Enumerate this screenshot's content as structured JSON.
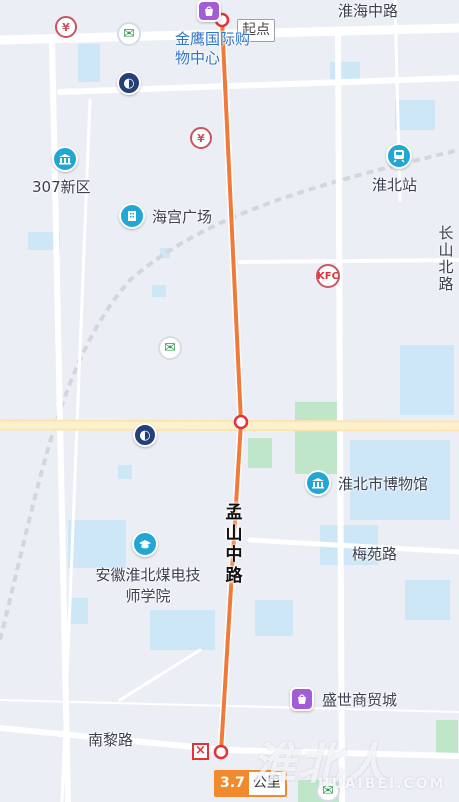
{
  "map": {
    "roads": {
      "huaihai_zhong": "淮海中路",
      "changshan_bei": "长山北路",
      "mengshan_zhong": "孟山中路",
      "meiyuan": "梅苑路",
      "nanli": "南黎路"
    },
    "pois": {
      "jinying": "金鹰国际购物中心",
      "huaibei_station": "淮北站",
      "district_307": "307新区",
      "haigong": "海宫广场",
      "museum": "淮北市博物馆",
      "technician_college": "安徽淮北煤电技师学院",
      "shengshi": "盛世商贸城"
    },
    "route": {
      "start_label": "起点",
      "distance_value": "3.7",
      "distance_unit": "公里",
      "color": "#f07a3a"
    },
    "icons": {
      "shopping": "shopping-bag-icon",
      "bank": "bank-icon",
      "post": "china-post-icon",
      "train": "train-station-icon",
      "museum": "museum-icon",
      "school": "graduation-cap-icon",
      "fast_food": "kfc-icon",
      "end": "end-flag-icon"
    },
    "watermark": {
      "main": "淮北人",
      "sub": "HUAIBEI.COM"
    }
  }
}
